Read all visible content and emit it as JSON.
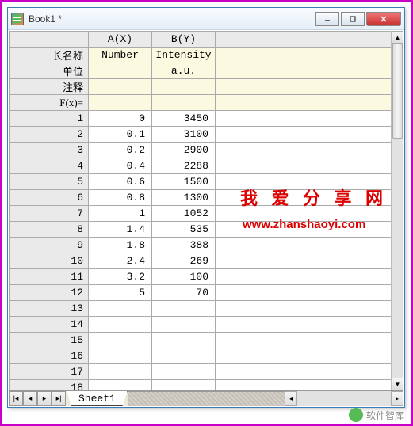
{
  "window": {
    "title": "Book1 *"
  },
  "columns": {
    "a": "A(X)",
    "b": "B(Y)"
  },
  "meta_labels": {
    "longname": "长名称",
    "units": "单位",
    "comments": "注释",
    "fx": "F(x)="
  },
  "meta": {
    "longname": {
      "a": "Number",
      "b": "Intensity"
    },
    "units": {
      "a": "",
      "b": "a.u."
    },
    "comments": {
      "a": "",
      "b": ""
    },
    "fx": {
      "a": "",
      "b": ""
    }
  },
  "rows": [
    {
      "n": "1",
      "a": "0",
      "b": "3450"
    },
    {
      "n": "2",
      "a": "0.1",
      "b": "3100"
    },
    {
      "n": "3",
      "a": "0.2",
      "b": "2900"
    },
    {
      "n": "4",
      "a": "0.4",
      "b": "2288"
    },
    {
      "n": "5",
      "a": "0.6",
      "b": "1500"
    },
    {
      "n": "6",
      "a": "0.8",
      "b": "1300"
    },
    {
      "n": "7",
      "a": "1",
      "b": "1052"
    },
    {
      "n": "8",
      "a": "1.4",
      "b": "535"
    },
    {
      "n": "9",
      "a": "1.8",
      "b": "388"
    },
    {
      "n": "10",
      "a": "2.4",
      "b": "269"
    },
    {
      "n": "11",
      "a": "3.2",
      "b": "100"
    },
    {
      "n": "12",
      "a": "5",
      "b": "70"
    },
    {
      "n": "13",
      "a": "",
      "b": ""
    },
    {
      "n": "14",
      "a": "",
      "b": ""
    },
    {
      "n": "15",
      "a": "",
      "b": ""
    },
    {
      "n": "16",
      "a": "",
      "b": ""
    },
    {
      "n": "17",
      "a": "",
      "b": ""
    },
    {
      "n": "18",
      "a": "",
      "b": ""
    }
  ],
  "sheet": {
    "name": "Sheet1"
  },
  "watermark": {
    "text1": "我 爱 分 享 网",
    "text2": "www.zhanshaoyi.com",
    "footer": "软件智库"
  }
}
